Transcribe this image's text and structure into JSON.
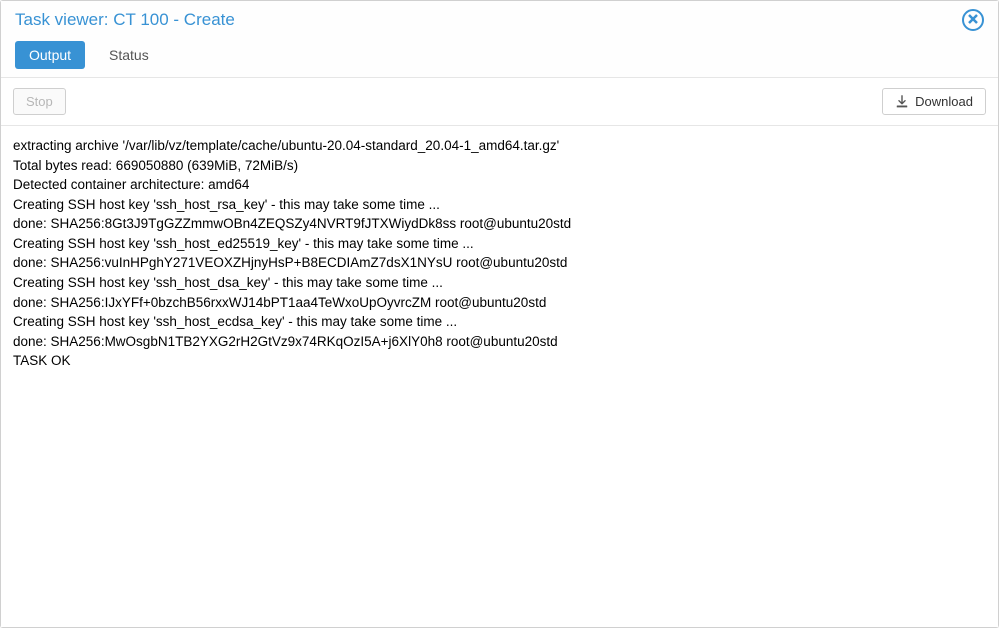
{
  "window": {
    "title": "Task viewer: CT 100 - Create"
  },
  "tabs": {
    "output": "Output",
    "status": "Status"
  },
  "toolbar": {
    "stop_label": "Stop",
    "download_label": "Download"
  },
  "log_lines": [
    "extracting archive '/var/lib/vz/template/cache/ubuntu-20.04-standard_20.04-1_amd64.tar.gz'",
    "Total bytes read: 669050880 (639MiB, 72MiB/s)",
    "Detected container architecture: amd64",
    "Creating SSH host key 'ssh_host_rsa_key' - this may take some time ...",
    "done: SHA256:8Gt3J9TgGZZmmwOBn4ZEQSZy4NVRT9fJTXWiydDk8ss root@ubuntu20std",
    "Creating SSH host key 'ssh_host_ed25519_key' - this may take some time ...",
    "done: SHA256:vuInHPghY271VEOXZHjnyHsP+B8ECDIAmZ7dsX1NYsU root@ubuntu20std",
    "Creating SSH host key 'ssh_host_dsa_key' - this may take some time ...",
    "done: SHA256:IJxYFf+0bzchB56rxxWJ14bPT1aa4TeWxoUpOyvrcZM root@ubuntu20std",
    "Creating SSH host key 'ssh_host_ecdsa_key' - this may take some time ...",
    "done: SHA256:MwOsgbN1TB2YXG2rH2GtVz9x74RKqOzI5A+j6XlY0h8 root@ubuntu20std",
    "TASK OK"
  ]
}
